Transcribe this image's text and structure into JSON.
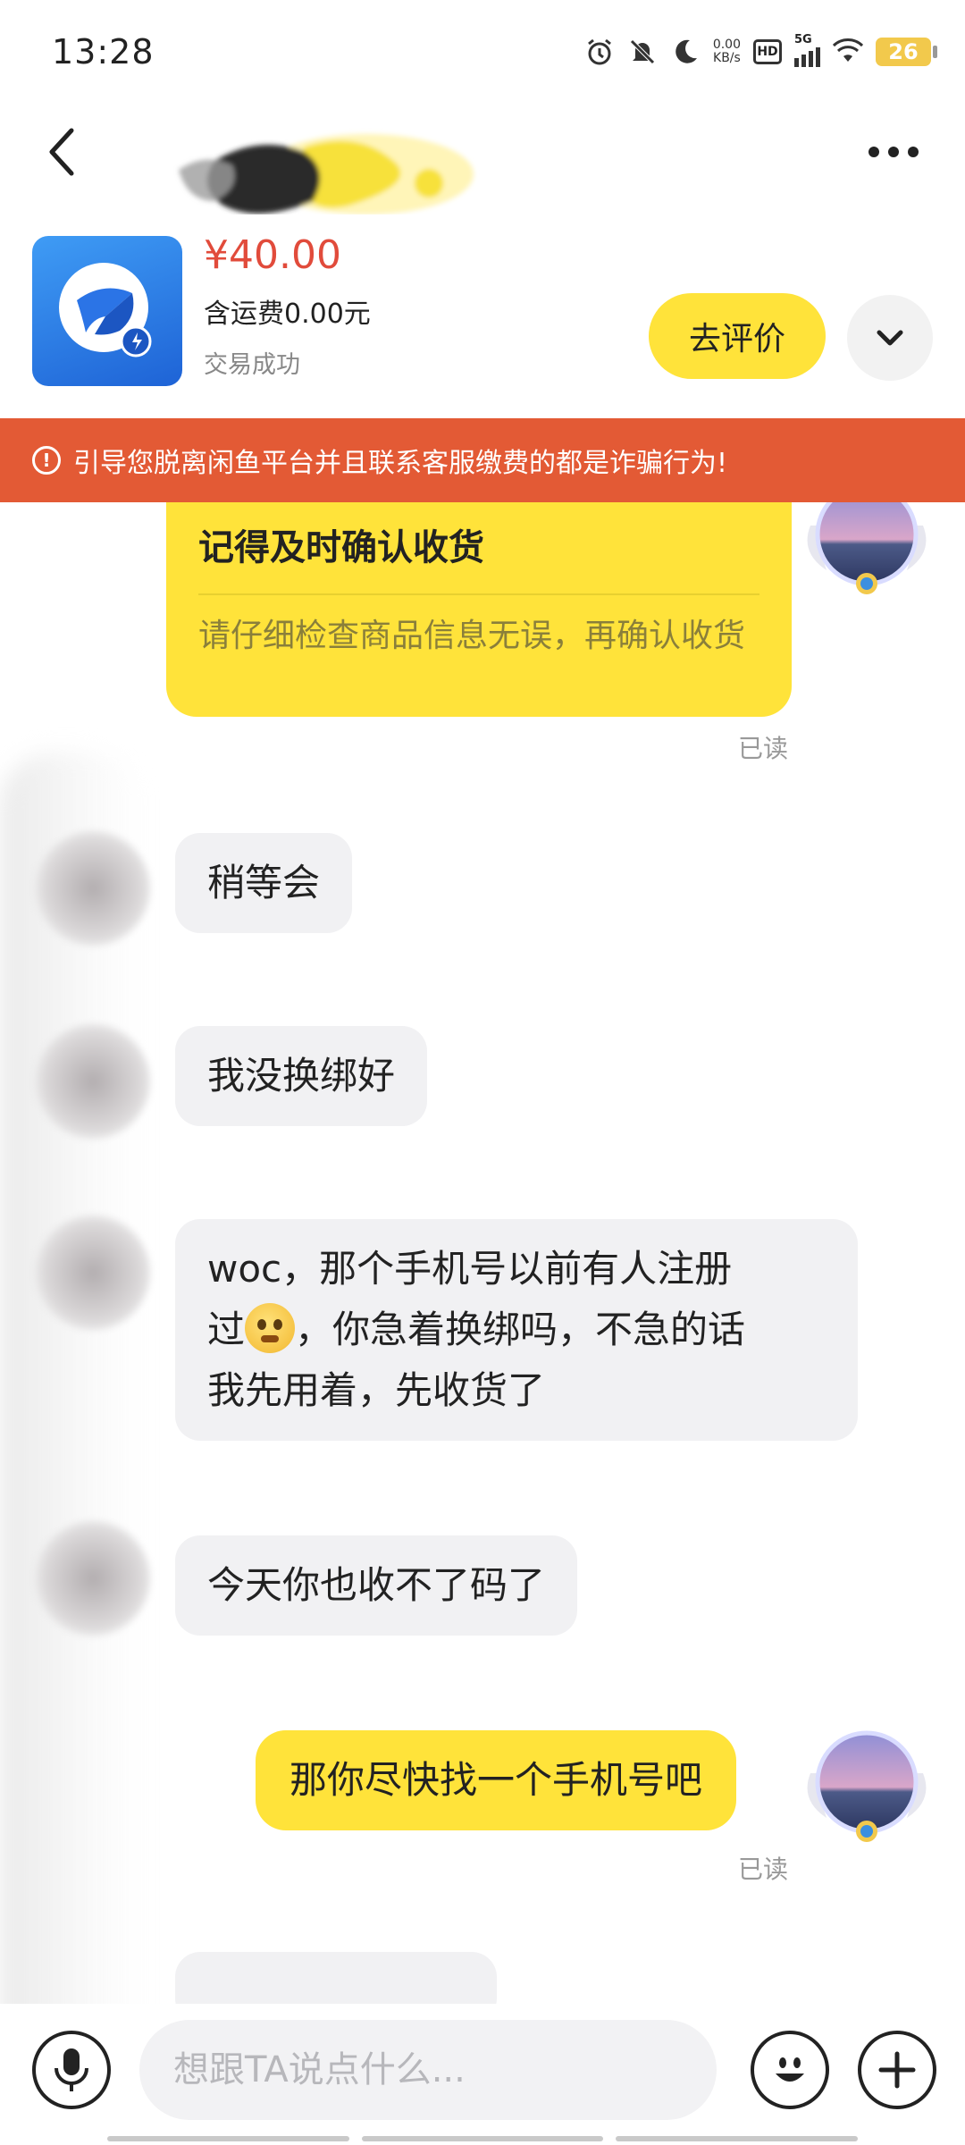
{
  "status_bar": {
    "time": "13:28",
    "net_speed_value": "0.00",
    "net_speed_unit": "KB/s",
    "hd_label": "HD",
    "signal_label": "5G",
    "battery": "26",
    "icons": [
      "alarm-icon",
      "mute-bell-icon",
      "moon-icon",
      "hd-icon",
      "signal-icon",
      "wifi-icon",
      "battery-icon"
    ]
  },
  "header": {
    "back_icon": "chevron-left-icon",
    "more_icon": "more-dots-icon"
  },
  "product": {
    "price": "¥40.00",
    "shipping": "含运费0.00元",
    "status": "交易成功",
    "review_button": "去评价",
    "expand_icon": "chevron-down-icon"
  },
  "warning": {
    "icon": "!",
    "text": "引导您脱离闲鱼平台并且联系客服缴费的都是诈骗行为!"
  },
  "messages": [
    {
      "id": "card",
      "direction": "out",
      "title": "记得及时确认收货",
      "body": "请仔细检查商品信息无误，再确认收货",
      "read": "已读"
    },
    {
      "id": "m1",
      "direction": "in",
      "text": "稍等会"
    },
    {
      "id": "m2",
      "direction": "in",
      "text": "我没换绑好"
    },
    {
      "id": "m3",
      "direction": "in",
      "line1": "woc，那个手机号以前有人注册",
      "line2_pre": "过",
      "line2_post": "，你急着换绑吗，不急的话",
      "line3": "我先用着，先收货了"
    },
    {
      "id": "m4",
      "direction": "in",
      "text": "今天你也收不了码了"
    },
    {
      "id": "m5",
      "direction": "out",
      "text": "那你尽快找一个手机号吧",
      "read": "已读"
    }
  ],
  "input_bar": {
    "placeholder": "想跟TA说点什么...",
    "mic_icon": "microphone-icon",
    "emoji_icon": "emoji-icon",
    "plus_icon": "plus-icon"
  },
  "colors": {
    "accent_yellow": "#ffe33a",
    "warning_red": "#e35a35",
    "price_red": "#e14b3b",
    "incoming_bubble": "#f1f1f3"
  }
}
